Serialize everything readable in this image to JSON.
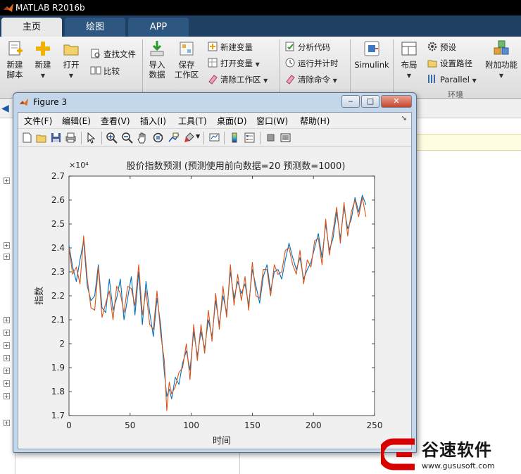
{
  "app": {
    "title": "MATLAB R2016b",
    "tabs": [
      {
        "label": "主页",
        "active": true
      },
      {
        "label": "绘图",
        "active": false
      },
      {
        "label": "APP",
        "active": false
      }
    ]
  },
  "ribbon": {
    "file": {
      "new_script": "新建\n脚本",
      "new": "新建",
      "open": "打开",
      "find_files": "查找文件",
      "compare": "比较"
    },
    "variable": {
      "import": "导入\n数据",
      "save_ws": "保存\n工作区",
      "new_var": "新建变量",
      "open_var": "打开变量",
      "clear_ws": "清除工作区"
    },
    "code": {
      "analyze": "分析代码",
      "run_time": "运行并计时",
      "clear_cmd": "清除命令"
    },
    "simulink": "Simulink",
    "environment": {
      "layout": "布局",
      "preferences": "预设",
      "set_path": "设置路径",
      "parallel": "Parallel",
      "addons": "附加功能",
      "section_label": "环境"
    }
  },
  "figure": {
    "title": "Figure 3",
    "menu": [
      "文件(F)",
      "编辑(E)",
      "查看(V)",
      "插入(I)",
      "工具(T)",
      "桌面(D)",
      "窗口(W)",
      "帮助(H)"
    ],
    "toolbar_icons": [
      "new-figure-icon",
      "open-file-icon",
      "save-icon",
      "print-icon",
      "select-arrow-icon",
      "zoom-in-icon",
      "zoom-out-icon",
      "pan-hand-icon",
      "rotate-3d-icon",
      "data-cursor-icon",
      "brush-icon",
      "link-plot-icon",
      "colorbar-icon",
      "legend-icon",
      "hide-plot-tools-icon",
      "show-plot-tools-icon"
    ],
    "window_buttons": {
      "minimize": "‒",
      "maximize": "□",
      "close": "✕"
    }
  },
  "chart_data": {
    "type": "line",
    "title": "股价指数预测 (预测使用前向数据=20 预测数=1000)",
    "xlabel": "时间",
    "ylabel": "指数",
    "exponent_label": "×10⁴",
    "xlim": [
      0,
      250
    ],
    "ylim": [
      1.7,
      2.7
    ],
    "xticks": [
      0,
      50,
      100,
      150,
      200,
      250
    ],
    "yticks": [
      1.7,
      1.8,
      1.9,
      2.0,
      2.1,
      2.2,
      2.3,
      2.4,
      2.5,
      2.6,
      2.7
    ],
    "ytick_labels": [
      "1.7",
      "1.8",
      "1.9",
      "2",
      "2.1",
      "2.2",
      "2.3",
      "2.4",
      "2.5",
      "2.6",
      "2.7"
    ],
    "colors": {
      "actual": "#0072bd",
      "predicted": "#d95319"
    },
    "x": [
      0,
      3,
      6,
      9,
      12,
      15,
      18,
      21,
      24,
      27,
      30,
      33,
      36,
      39,
      42,
      45,
      48,
      51,
      54,
      57,
      60,
      63,
      66,
      69,
      72,
      75,
      78,
      80,
      82,
      84,
      87,
      90,
      93,
      96,
      99,
      102,
      105,
      108,
      111,
      114,
      117,
      120,
      123,
      126,
      129,
      132,
      135,
      138,
      141,
      144,
      147,
      150,
      153,
      156,
      159,
      162,
      165,
      168,
      171,
      174,
      177,
      180,
      183,
      186,
      189,
      192,
      195,
      198,
      201,
      204,
      207,
      210,
      213,
      216,
      219,
      222,
      225,
      228,
      231,
      234,
      237,
      240,
      243
    ],
    "series": [
      {
        "values": [
          2.41,
          2.32,
          2.26,
          2.35,
          2.43,
          2.24,
          2.18,
          2.2,
          2.33,
          2.15,
          2.13,
          2.27,
          2.14,
          2.19,
          2.27,
          2.1,
          2.19,
          2.28,
          2.12,
          2.3,
          2.08,
          2.26,
          2.13,
          2.03,
          2.19,
          2.08,
          1.88,
          1.78,
          1.81,
          1.77,
          1.86,
          1.83,
          1.92,
          1.97,
          1.89,
          2.05,
          1.95,
          2.05,
          1.98,
          2.1,
          2.03,
          2.18,
          2.08,
          2.2,
          2.13,
          2.3,
          2.19,
          2.26,
          2.21,
          2.25,
          2.16,
          2.31,
          2.24,
          2.17,
          2.28,
          2.33,
          2.22,
          2.3,
          2.31,
          2.27,
          2.35,
          2.42,
          2.36,
          2.31,
          2.36,
          2.27,
          2.31,
          2.34,
          2.4,
          2.46,
          2.36,
          2.5,
          2.39,
          2.44,
          2.55,
          2.44,
          2.57,
          2.48,
          2.52,
          2.61,
          2.55,
          2.62,
          2.58
        ]
      },
      {
        "values": [
          2.4,
          2.29,
          2.32,
          2.25,
          2.45,
          2.27,
          2.15,
          2.14,
          2.32,
          2.11,
          2.17,
          2.22,
          2.1,
          2.24,
          2.21,
          2.13,
          2.24,
          2.23,
          2.16,
          2.33,
          2.12,
          2.22,
          2.08,
          2.06,
          2.22,
          2.04,
          1.93,
          1.72,
          1.84,
          1.79,
          1.82,
          1.88,
          1.9,
          2.0,
          1.85,
          2.08,
          1.93,
          2.08,
          1.96,
          2.14,
          2.01,
          2.21,
          2.06,
          2.24,
          2.11,
          2.33,
          2.16,
          2.29,
          2.18,
          2.28,
          2.14,
          2.34,
          2.2,
          2.19,
          2.31,
          2.31,
          2.2,
          2.33,
          2.29,
          2.3,
          2.39,
          2.4,
          2.33,
          2.29,
          2.39,
          2.25,
          2.35,
          2.32,
          2.43,
          2.44,
          2.33,
          2.52,
          2.37,
          2.47,
          2.57,
          2.42,
          2.59,
          2.45,
          2.55,
          2.6,
          2.53,
          2.61,
          2.53
        ]
      }
    ]
  },
  "watermark": {
    "text": "谷速软件",
    "url": "www.gususoft.com"
  }
}
